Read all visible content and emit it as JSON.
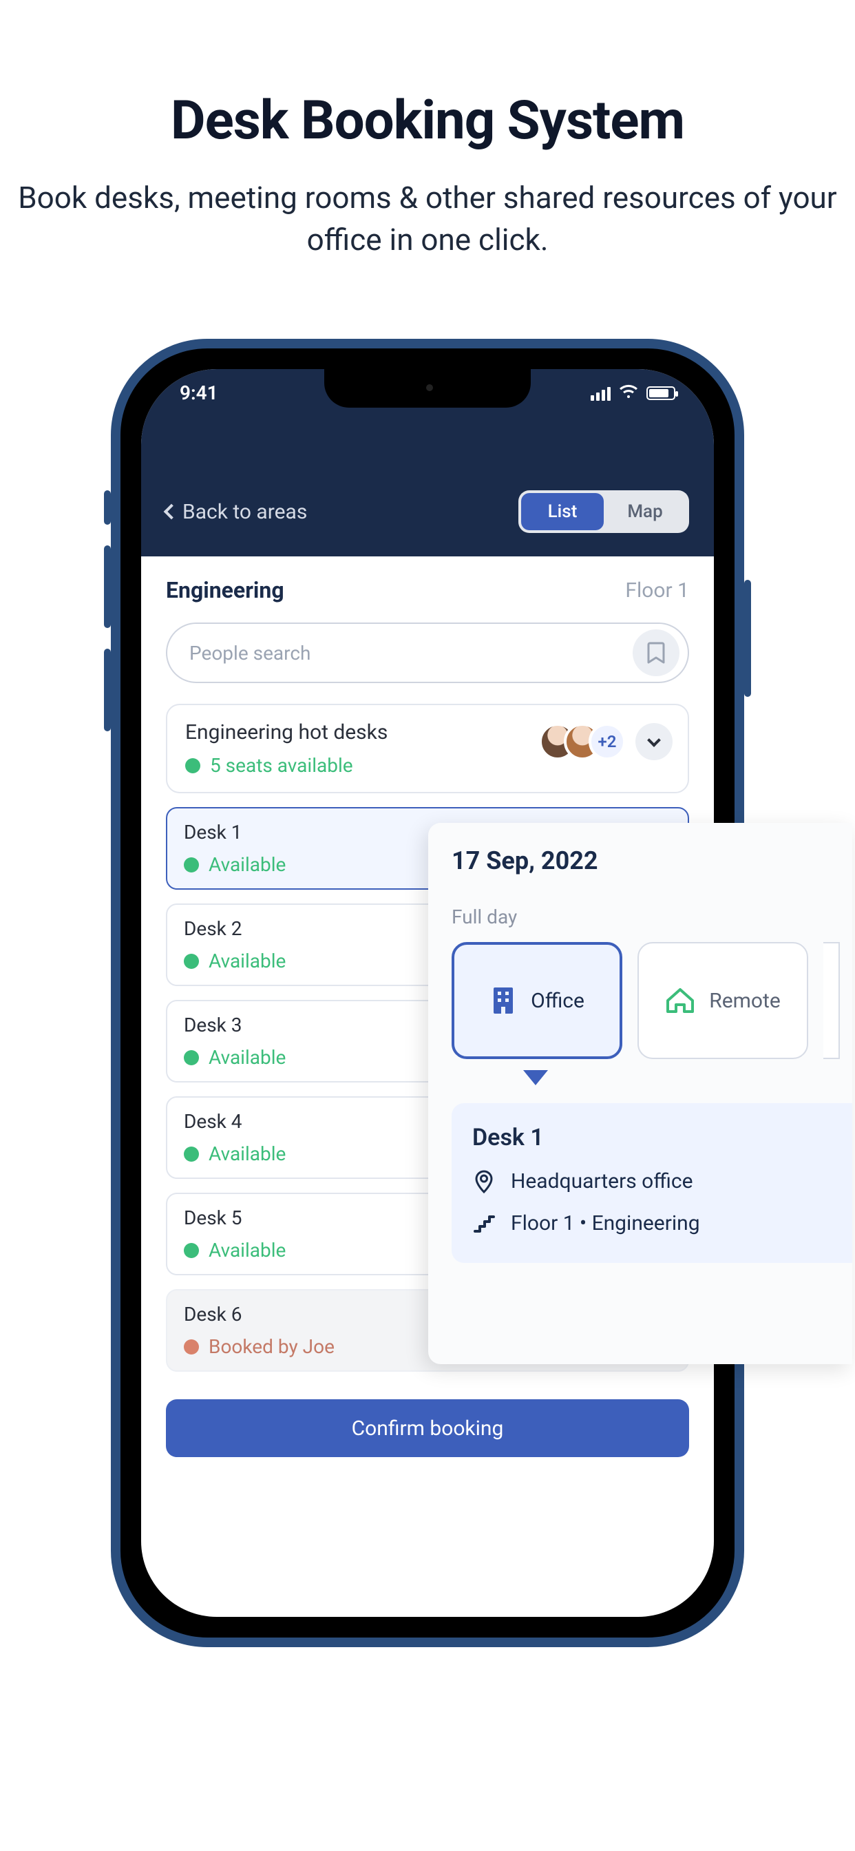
{
  "hero": {
    "title": "Desk Booking System",
    "subtitle": "Book desks, meeting rooms & other shared resources of your office in one click."
  },
  "status": {
    "time": "9:41"
  },
  "nav": {
    "back_label": "Back to areas",
    "tabs": {
      "list": "List",
      "map": "Map"
    }
  },
  "area": {
    "name": "Engineering",
    "floor": "Floor 1"
  },
  "search": {
    "placeholder": "People search"
  },
  "hotdesks": {
    "title": "Engineering hot desks",
    "availability": "5 seats available",
    "extra_badge": "+2"
  },
  "desks": [
    {
      "name": "Desk 1",
      "status": "Available",
      "selected": true
    },
    {
      "name": "Desk 2",
      "status": "Available"
    },
    {
      "name": "Desk 3",
      "status": "Available"
    },
    {
      "name": "Desk 4",
      "status": "Available"
    },
    {
      "name": "Desk 5",
      "status": "Available"
    },
    {
      "name": "Desk 6",
      "status": "Booked by Joe",
      "booked": true
    }
  ],
  "confirm_label": "Confirm booking",
  "popover": {
    "date": "17 Sep, 2022",
    "subtitle": "Full day",
    "options": {
      "office": "Office",
      "remote": "Remote"
    },
    "desk": {
      "name": "Desk 1",
      "office": "Headquarters office",
      "location": "Floor 1 • Engineering"
    }
  }
}
